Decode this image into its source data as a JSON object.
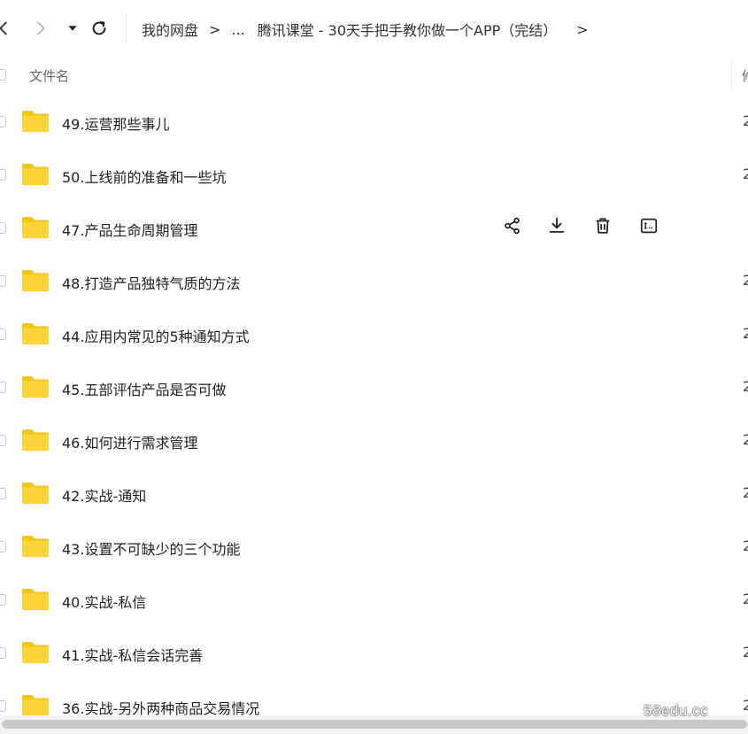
{
  "toolbar": {
    "back_icon": "chevron-left-icon",
    "forward_icon": "chevron-right-icon",
    "dropdown_icon": "caret-down-icon",
    "refresh_icon": "refresh-icon"
  },
  "breadcrumb": {
    "root": "我的网盘",
    "ellipsis": "...",
    "current": "腾讯课堂 - 30天手把手教你做一个APP（完结）",
    "separator": ">"
  },
  "header": {
    "name_label": "文件名",
    "col2_label": "修"
  },
  "files": [
    {
      "name": "49.运营那些事儿",
      "date": "2"
    },
    {
      "name": "50.上线前的准备和一些坑",
      "date": "2"
    },
    {
      "name": "47.产品生命周期管理",
      "date": ""
    },
    {
      "name": "48.打造产品独特气质的方法",
      "date": "2"
    },
    {
      "name": "44.应用内常见的5种通知方式",
      "date": "2"
    },
    {
      "name": "45.五部评估产品是否可做",
      "date": "2"
    },
    {
      "name": "46.如何进行需求管理",
      "date": "2"
    },
    {
      "name": "42.实战-通知",
      "date": "2"
    },
    {
      "name": "43.设置不可缺少的三个功能",
      "date": "2"
    },
    {
      "name": "40.实战-私信",
      "date": "2"
    },
    {
      "name": "41.实战-私信会话完善",
      "date": "2"
    },
    {
      "name": "36.实战-另外两种商品交易情况",
      "date": "2"
    }
  ],
  "row_actions": [
    "share-icon",
    "download-icon",
    "delete-icon",
    "rename-icon"
  ],
  "colors": {
    "folder": "#FFD43B",
    "folder_dark": "#F5C518"
  },
  "watermark": "58edu.cc"
}
